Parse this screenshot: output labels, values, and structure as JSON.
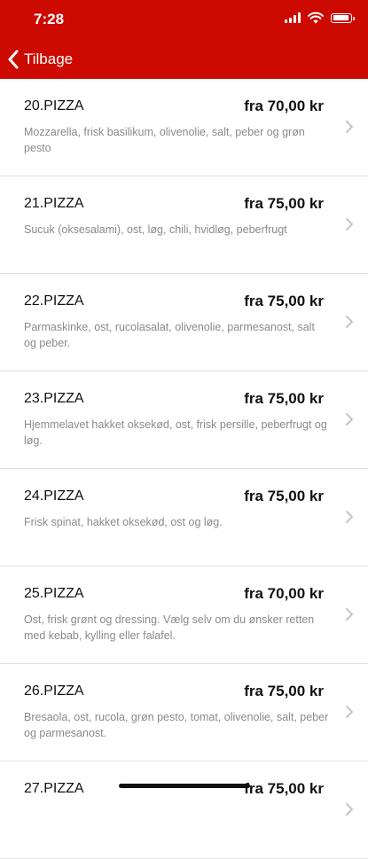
{
  "status_bar": {
    "time": "7:28"
  },
  "nav": {
    "back_label": "Tilbage"
  },
  "items": [
    {
      "name": "20.PIZZA",
      "price": "fra 70,00 kr",
      "description": "Mozzarella, frisk basilikum, olivenolie, salt, peber og grøn pesto"
    },
    {
      "name": "21.PIZZA",
      "price": "fra 75,00 kr",
      "description": "Sucuk (oksesalami), ost, løg, chili, hvidløg, peberfrugt"
    },
    {
      "name": "22.PIZZA",
      "price": "fra 75,00 kr",
      "description": "Parmaskinke, ost, rucolasalat, olivenolie, parmesanost, salt og peber."
    },
    {
      "name": "23.PIZZA",
      "price": "fra 75,00 kr",
      "description": "Hjemmelavet hakket oksekød, ost, frisk persille, peberfrugt og løg."
    },
    {
      "name": "24.PIZZA",
      "price": "fra 75,00 kr",
      "description": "Frisk spinat, hakket oksekød, ost og løg."
    },
    {
      "name": "25.PIZZA",
      "price": "fra 70,00 kr",
      "description": "Ost, frisk grønt og dressing. Vælg selv om du ønsker retten med kebab, kylling eller falafel."
    },
    {
      "name": "26.PIZZA",
      "price": "fra 75,00 kr",
      "description": "Bresaola, ost, rucola, grøn pesto, tomat, olivenolie, salt, peber og parmesanost."
    },
    {
      "name": "27.PIZZA",
      "price": "fra 75,00 kr",
      "description": ""
    }
  ],
  "colors": {
    "header_bg": "#cc0a02",
    "text": "#111111",
    "description": "#8a8a8a",
    "divider": "#e1e1e1"
  }
}
